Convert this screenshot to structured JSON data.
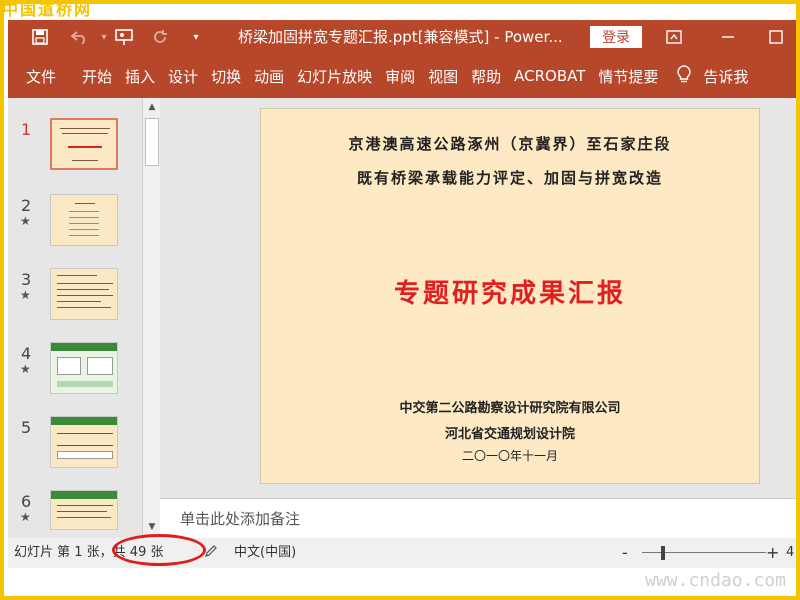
{
  "watermark_top": "中国道桥网",
  "watermark_bottom": "www.cndao.com",
  "titlebar": {
    "save_icon": "save-icon",
    "undo_icon": "undo-icon",
    "present_icon": "present-icon",
    "redo_icon": "redo-icon",
    "customize_icon": "customize-qa-icon",
    "document_title": "桥梁加固拼宽专题汇报.ppt[兼容模式]  -  Power...",
    "login_label": "登录",
    "ribbon_display_icon": "ribbon-display-icon",
    "minimize_icon": "minimize-icon",
    "maximize_icon": "maximize-icon"
  },
  "ribbon_tabs": [
    "文件",
    "开始",
    "插入",
    "设计",
    "切换",
    "动画",
    "幻灯片放映",
    "审阅",
    "视图",
    "帮助",
    "ACROBAT",
    "情节提要"
  ],
  "tell_me": {
    "icon": "lightbulb-icon",
    "label": "告诉我"
  },
  "thumbnails": [
    {
      "number": "1",
      "star": ""
    },
    {
      "number": "2",
      "star": "★"
    },
    {
      "number": "3",
      "star": "★"
    },
    {
      "number": "4",
      "star": "★"
    },
    {
      "number": "5",
      "star": ""
    },
    {
      "number": "6",
      "star": "★"
    }
  ],
  "slide": {
    "line1": "京港澳高速公路涿州（京冀界）至石家庄段",
    "line2": "既有桥梁承载能力评定、加固与拼宽改造",
    "main_title": "专题研究成果汇报",
    "org1": "中交第二公路勘察设计研究院有限公司",
    "org2": "河北省交通规划设计院",
    "date": "二〇一〇年十一月"
  },
  "notes_placeholder": "单击此处添加备注",
  "statusbar": {
    "slide_info": "幻灯片 第 1 张，共 49 张",
    "notes_icon": "notes-edit-icon",
    "language": "中文(中国)",
    "zoom_minus": "-",
    "zoom_plus": "+",
    "zoom_value": "4"
  },
  "colors": {
    "ribbon": "#b7472a",
    "frame": "#f5c400",
    "slide_bg": "#fde9c4",
    "title_red": "#e02020",
    "annotation_red": "#e01c1c"
  }
}
